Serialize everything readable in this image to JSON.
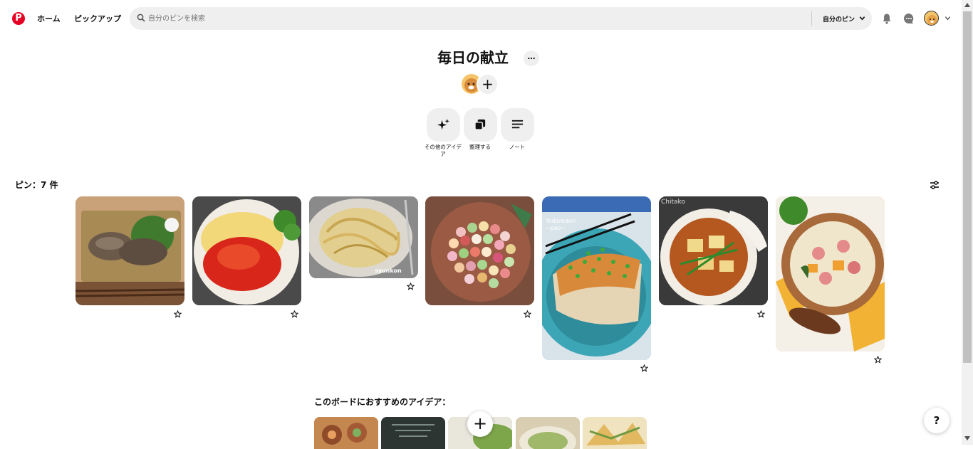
{
  "header": {
    "logo": "P",
    "nav_home": "ホーム",
    "nav_pickup": "ピックアップ",
    "search_placeholder": "自分のピンを検索",
    "scope_label": "自分のピン"
  },
  "board": {
    "title": "毎日の献立",
    "more_label": "…",
    "add_collaborator": "+",
    "actions": [
      {
        "label": "その他のアイデア",
        "icon": "sparkle-icon"
      },
      {
        "label": "整理する",
        "icon": "organize-icon"
      },
      {
        "label": "ノート",
        "icon": "notes-icon"
      }
    ],
    "pins_count": "ピン：7 件"
  },
  "pins": [
    {
      "name": "grilled-fish",
      "colors": [
        "#b99568",
        "#7c6a58",
        "#3f7a2e"
      ]
    },
    {
      "name": "omurice-tomato",
      "colors": [
        "#f3e6d6",
        "#e12b14",
        "#3f8a2b"
      ]
    },
    {
      "name": "carbonara",
      "colors": [
        "#e7d6a0",
        "#c9a752",
        "#6b6b6b"
      ],
      "watermark": "syunkon"
    },
    {
      "name": "temari-sushi",
      "colors": [
        "#8a5a48",
        "#d4a8a4",
        "#5f8f4a"
      ]
    },
    {
      "name": "chicken-dish",
      "colors": [
        "#3fa9b8",
        "#e9d8b8",
        "#d48a3a"
      ],
      "watermark": "Yodaredori ~pao~"
    },
    {
      "name": "mapo-tofu",
      "colors": [
        "#3b3b3b",
        "#c46a27",
        "#2d8a2c"
      ],
      "watermark": "Chitako"
    },
    {
      "name": "chowder",
      "colors": [
        "#f2b233",
        "#e8d7b0",
        "#6b3a1e"
      ]
    }
  ],
  "ideas": {
    "title": "このボードにおすすめのアイデア：",
    "fab": "+",
    "help": "?"
  },
  "colors": {
    "brand": "#e60023",
    "chip": "#efefef"
  }
}
